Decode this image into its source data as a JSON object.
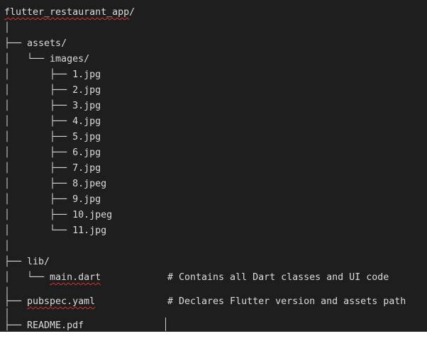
{
  "lines": [
    {
      "prefix": "",
      "name": "flutter_restaurant_app",
      "suffix": "/",
      "comment": ""
    },
    {
      "prefix": "│",
      "name": "",
      "suffix": "",
      "comment": ""
    },
    {
      "prefix": "├── ",
      "name": "assets/",
      "suffix": "",
      "comment": ""
    },
    {
      "prefix": "│   └── ",
      "name": "images/",
      "suffix": "",
      "comment": ""
    },
    {
      "prefix": "│       ├── ",
      "name": "1.jpg",
      "suffix": "",
      "comment": ""
    },
    {
      "prefix": "│       ├── ",
      "name": "2.jpg",
      "suffix": "",
      "comment": ""
    },
    {
      "prefix": "│       ├── ",
      "name": "3.jpg",
      "suffix": "",
      "comment": ""
    },
    {
      "prefix": "│       ├── ",
      "name": "4.jpg",
      "suffix": "",
      "comment": ""
    },
    {
      "prefix": "│       ├── ",
      "name": "5.jpg",
      "suffix": "",
      "comment": ""
    },
    {
      "prefix": "│       ├── ",
      "name": "6.jpg",
      "suffix": "",
      "comment": ""
    },
    {
      "prefix": "│       ├── ",
      "name": "7.jpg",
      "suffix": "",
      "comment": ""
    },
    {
      "prefix": "│       ├── ",
      "name": "8.jpeg",
      "suffix": "",
      "comment": ""
    },
    {
      "prefix": "│       ├── ",
      "name": "9.jpg",
      "suffix": "",
      "comment": ""
    },
    {
      "prefix": "│       ├── ",
      "name": "10.jpeg",
      "suffix": "",
      "comment": ""
    },
    {
      "prefix": "│       └── ",
      "name": "11.jpg",
      "suffix": "",
      "comment": ""
    },
    {
      "prefix": "│",
      "name": "",
      "suffix": "",
      "comment": ""
    },
    {
      "prefix": "├── ",
      "name": "lib/",
      "suffix": "",
      "comment": ""
    },
    {
      "prefix": "│   └── ",
      "name": "main.dart",
      "suffix": "",
      "comment": "# Contains all Dart classes and UI code"
    },
    {
      "prefix": "│",
      "name": "",
      "suffix": "",
      "comment": ""
    },
    {
      "prefix": "├── ",
      "name": "pubspec.yaml",
      "suffix": "",
      "comment": "# Declares Flutter version and assets path"
    },
    {
      "prefix": "│",
      "name": "",
      "suffix": "",
      "comment": ""
    },
    {
      "prefix": "├── ",
      "name": "README.pdf",
      "suffix": "",
      "comment": ""
    }
  ],
  "colors": {
    "background": "#1e1e1e",
    "text": "#dcdcdc",
    "spellcheck_underline": "#e03030"
  }
}
